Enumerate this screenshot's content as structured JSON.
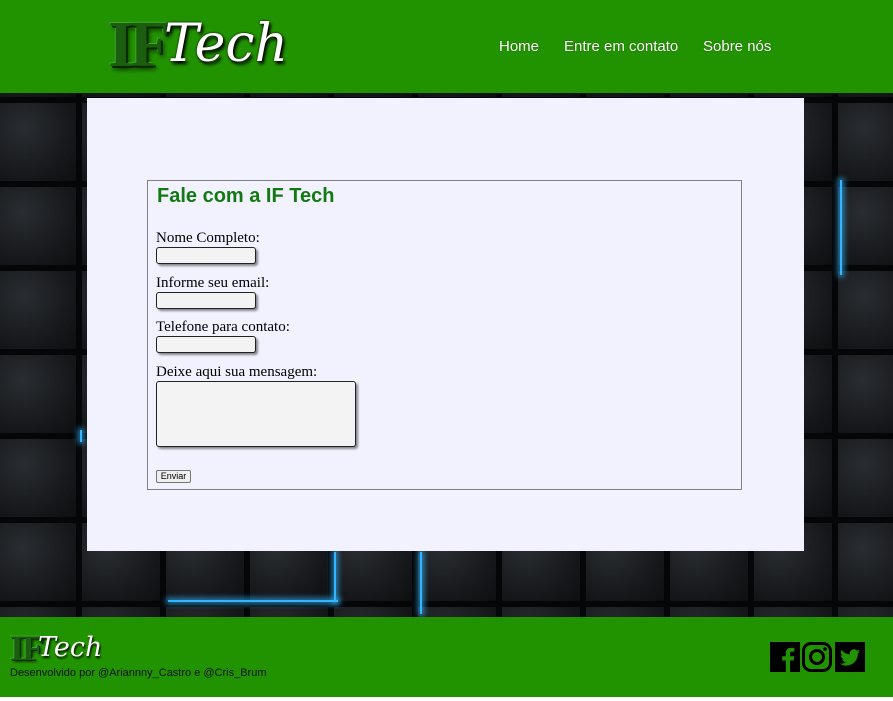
{
  "header": {
    "logo": {
      "prefix": "IF",
      "suffix": "Tech"
    },
    "nav": [
      {
        "label": "Home"
      },
      {
        "label": "Entre em contato"
      },
      {
        "label": "Sobre nós"
      }
    ]
  },
  "form": {
    "title": "Fale com a IF Tech",
    "fields": [
      {
        "label": "Nome Completo:",
        "value": "",
        "placeholder": ""
      },
      {
        "label": "Informe seu email:",
        "value": "",
        "placeholder": ""
      },
      {
        "label": "Telefone para contato:",
        "value": "",
        "placeholder": ""
      }
    ],
    "message": {
      "label": "Deixe aqui sua mensagem:",
      "value": ""
    },
    "submit_label": "Enviar"
  },
  "footer": {
    "logo": {
      "prefix": "IF",
      "suffix": "Tech"
    },
    "credits": "Desenvolvido por @Ariannny_Castro e @Cris_Brum",
    "social": [
      {
        "icon": "facebook-icon"
      },
      {
        "icon": "instagram-icon"
      },
      {
        "icon": "twitter-icon"
      }
    ]
  },
  "colors": {
    "brand_green": "#229300",
    "title_green": "#137a13",
    "panel_bg": "#f1f2fd",
    "accent_blue": "#33b6ff"
  }
}
